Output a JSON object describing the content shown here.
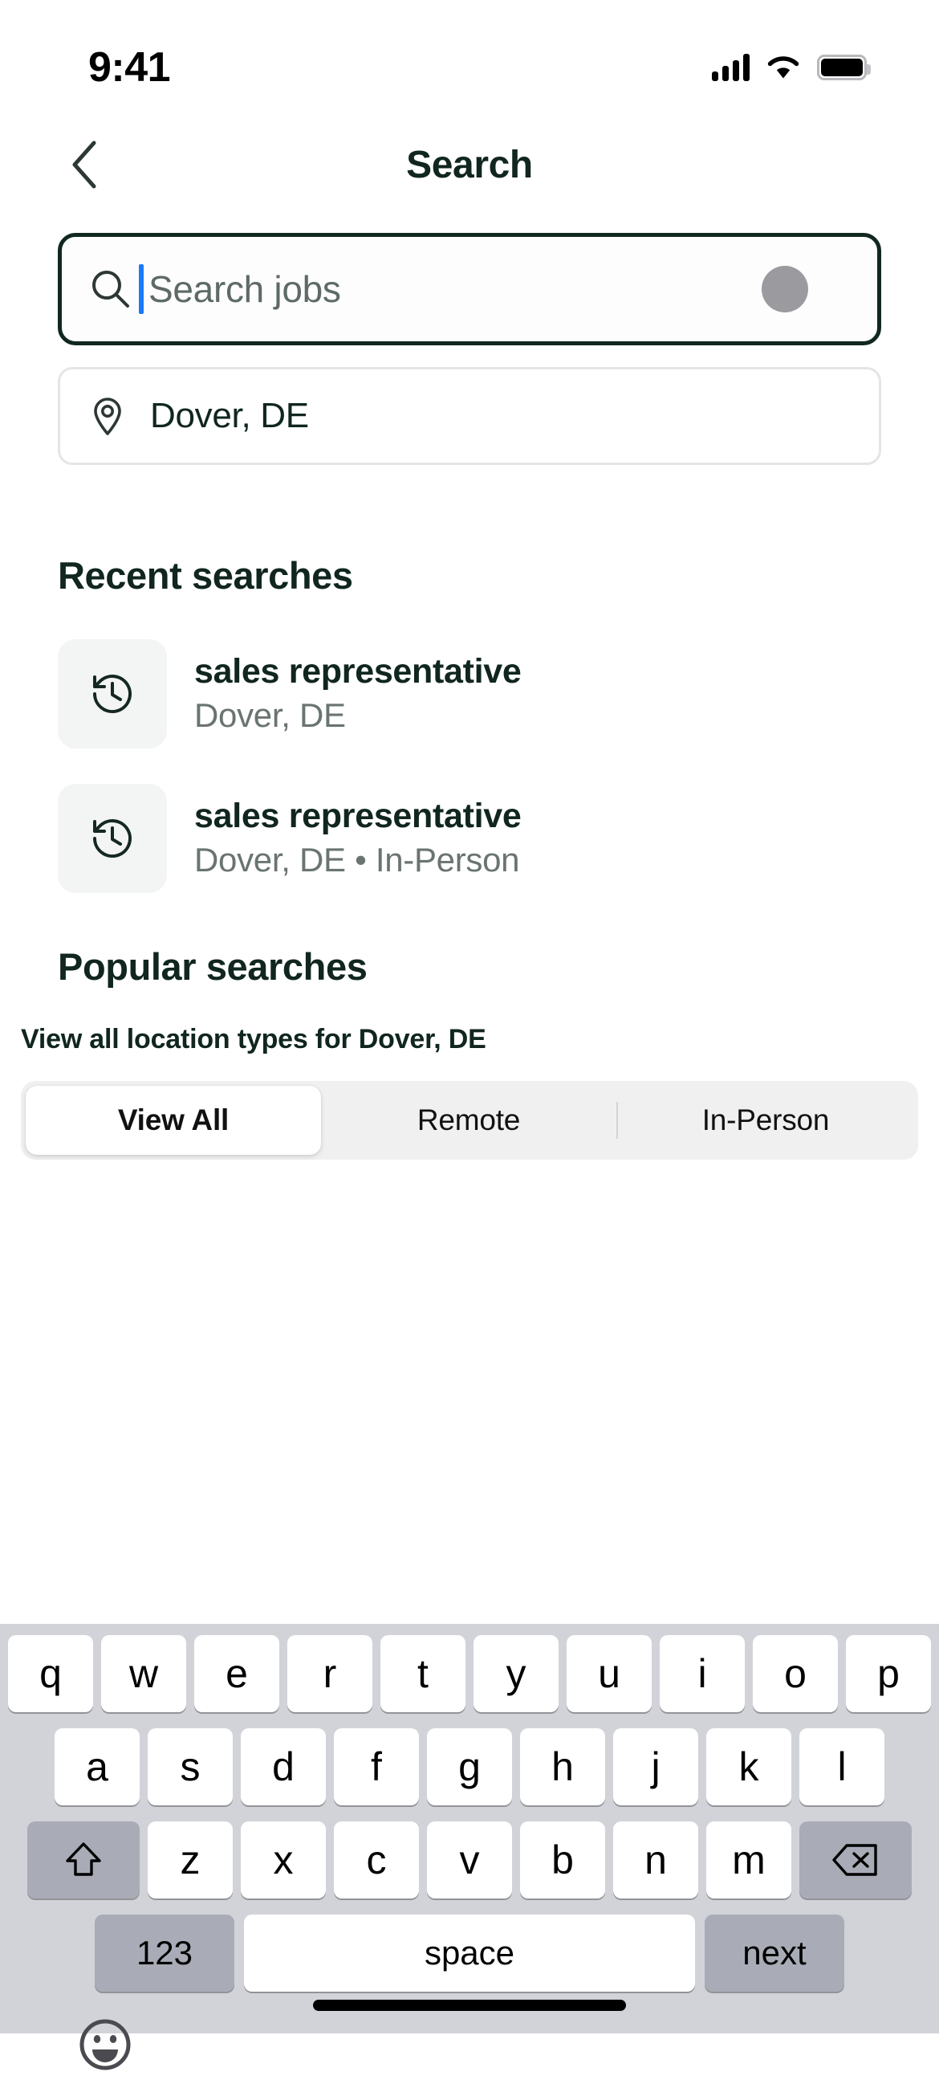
{
  "status_bar": {
    "time": "9:41",
    "signal_icon": "cellular-signal-icon",
    "wifi_icon": "wifi-icon",
    "battery_icon": "battery-icon"
  },
  "header": {
    "back_icon": "chevron-left-icon",
    "title": "Search",
    "title_color": "#10261e"
  },
  "search": {
    "search_icon": "magnifier-icon",
    "placeholder": "Search jobs",
    "value": "",
    "caret_color": "#1a7af8",
    "focused": true,
    "touch_indicator": "touch-point-indicator"
  },
  "location": {
    "pin_icon": "map-pin-icon",
    "value": "Dover, DE"
  },
  "recent": {
    "heading": "Recent searches",
    "items": [
      {
        "icon": "history-clock-icon",
        "title": "sales representative",
        "subtitle": "Dover, DE"
      },
      {
        "icon": "history-clock-icon",
        "title": "sales representative",
        "subtitle": "Dover, DE • In-Person"
      }
    ]
  },
  "popular": {
    "heading": "Popular searches",
    "subheading": "View all location types for Dover, DE",
    "tabs": [
      {
        "label": "View All",
        "selected": true
      },
      {
        "label": "Remote",
        "selected": false
      },
      {
        "label": "In-Person",
        "selected": false
      }
    ]
  },
  "keyboard": {
    "row1": [
      "q",
      "w",
      "e",
      "r",
      "t",
      "y",
      "u",
      "i",
      "o",
      "p"
    ],
    "row2": [
      "a",
      "s",
      "d",
      "f",
      "g",
      "h",
      "j",
      "k",
      "l"
    ],
    "row3": [
      "z",
      "x",
      "c",
      "v",
      "b",
      "n",
      "m"
    ],
    "shift_icon": "shift-arrow-icon",
    "backspace_icon": "backspace-icon",
    "numbers_key": "123",
    "space_key": "space",
    "return_key": "next",
    "emoji_icon": "emoji-smiley-icon"
  },
  "home_indicator": "home-indicator-bar"
}
